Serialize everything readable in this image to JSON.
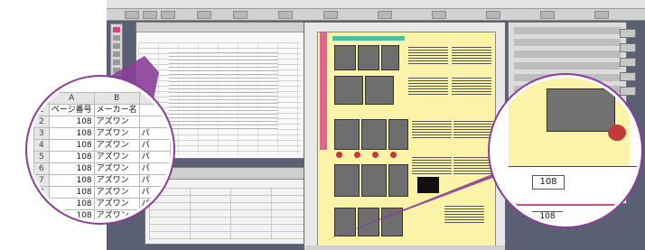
{
  "colors": {
    "desktop": "#5a5f73",
    "callout": "#8a3e98",
    "page_yellow": "#fbf3a8",
    "page_pink": "#e0668f",
    "page_green": "#48c0a0",
    "page_red": "#c23a3a"
  },
  "spreadsheet_zoom": {
    "corner_icon": "diamond-icon",
    "columns": [
      "A",
      "B"
    ],
    "rows": [
      {
        "num": "1",
        "a": "ページ番号",
        "b": "メーカー名"
      },
      {
        "num": "2",
        "a": "108",
        "b": "アズワン"
      },
      {
        "num": "3",
        "a": "108",
        "b": "アズワン",
        "c": "パ"
      },
      {
        "num": "4",
        "a": "108",
        "b": "アズワン",
        "c": "パ"
      },
      {
        "num": "5",
        "a": "108",
        "b": "アズワン",
        "c": "パ"
      },
      {
        "num": "6",
        "a": "108",
        "b": "アズワン",
        "c": "パ"
      },
      {
        "num": "7",
        "a": "108",
        "b": "アズワン",
        "c": "パ"
      },
      {
        "num": "8",
        "a": "108",
        "b": "アズワン",
        "c": "パ"
      },
      {
        "num": "9",
        "a": "108",
        "b": "アズワン",
        "c": "パ"
      },
      {
        "num": "",
        "a": "108",
        "b": "アズワン"
      }
    ]
  },
  "page_zoom": {
    "page_number": "108",
    "page_number_partial": "108"
  }
}
